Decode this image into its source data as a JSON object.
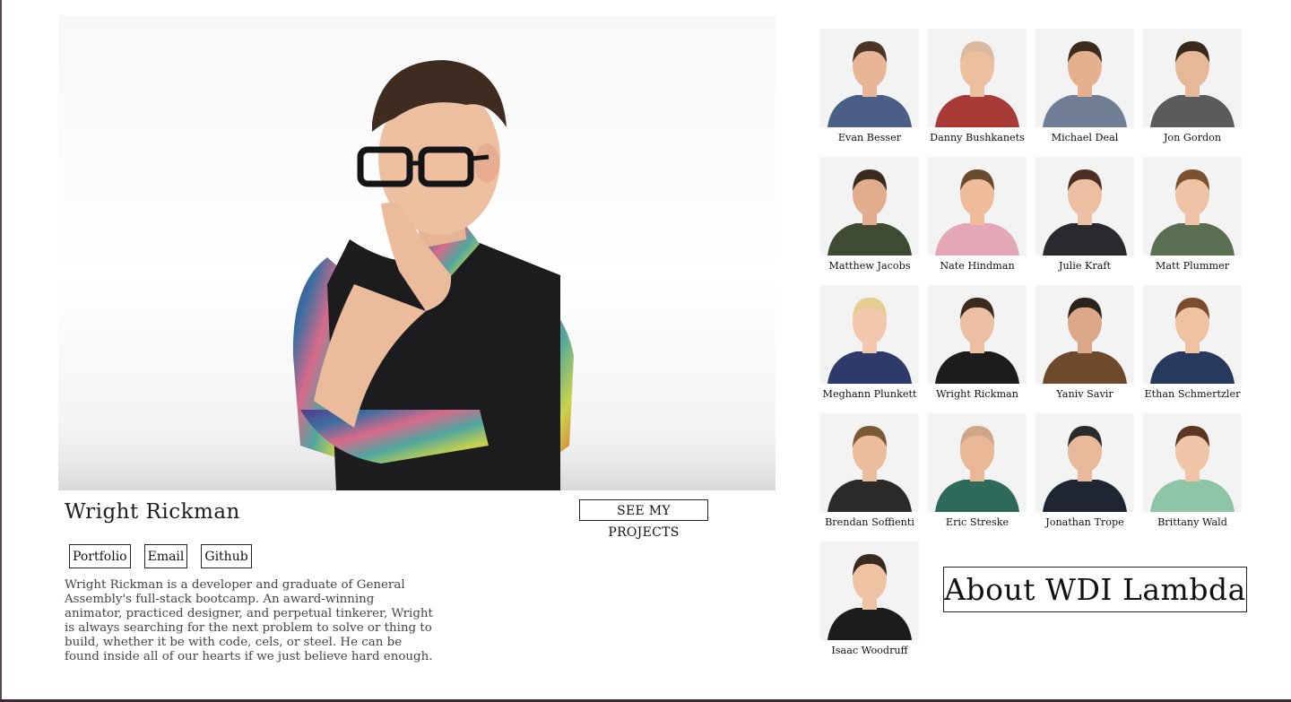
{
  "featured": {
    "name": "Wright Rickman",
    "projects_label": "SEE MY PROJECTS",
    "links": [
      "Portfolio",
      "Email",
      "Github"
    ],
    "bio": "Wright Rickman is a developer and graduate of General Assembly's full-stack bootcamp. An award-winning animator, practiced designer, and perpetual tinkerer, Wright is always searching for the next problem to solve or thing to build, whether it be with code, cels, or steel. He can be found inside all of our hearts if we just believe hard enough."
  },
  "people": [
    {
      "name": "Evan Besser",
      "shirt": "#4a5f86",
      "hair": "#4a3526",
      "skin": "#e8b596"
    },
    {
      "name": "Danny Bushkanets",
      "shirt": "#a83a38",
      "hair": "#d9b9a0",
      "skin": "#ecbf9f"
    },
    {
      "name": "Michael Deal",
      "shirt": "#6f7e94",
      "hair": "#3c2b1f",
      "skin": "#e4b08e"
    },
    {
      "name": "Jon Gordon",
      "shirt": "#5b5b5b",
      "hair": "#3a2a1e",
      "skin": "#e6b897"
    },
    {
      "name": "Matthew Jacobs",
      "shirt": "#3f4a33",
      "hair": "#3b2a1f",
      "skin": "#e1ad8c"
    },
    {
      "name": "Nate Hindman",
      "shirt": "#e3a7b8",
      "hair": "#6a4a2c",
      "skin": "#efbd9b"
    },
    {
      "name": "Julie Kraft",
      "shirt": "#2a2a2e",
      "hair": "#4a2f22",
      "skin": "#eec0a3"
    },
    {
      "name": "Matt Plummer",
      "shirt": "#5a6e52",
      "hair": "#7a5232",
      "skin": "#efc4a6"
    },
    {
      "name": "Meghann Plunkett",
      "shirt": "#2d3a6a",
      "hair": "#e3cd8f",
      "skin": "#f1c8ad"
    },
    {
      "name": "Wright Rickman",
      "shirt": "#1c1c1c",
      "hair": "#3b2a1e",
      "skin": "#edbfa2"
    },
    {
      "name": "Yaniv Savir",
      "shirt": "#6e4a2c",
      "hair": "#2a221c",
      "skin": "#dba88a"
    },
    {
      "name": "Ethan Schmertzler",
      "shirt": "#263a5c",
      "hair": "#7a4d2c",
      "skin": "#efc2a3"
    },
    {
      "name": "Brendan Soffienti",
      "shirt": "#2a2a2a",
      "hair": "#7a5a34",
      "skin": "#ecbd9c"
    },
    {
      "name": "Eric Streske",
      "shirt": "#2e6a5a",
      "hair": "#cfa68a",
      "skin": "#e9b696"
    },
    {
      "name": "Jonathan Trope",
      "shirt": "#1f2533",
      "hair": "#2a2a2a",
      "skin": "#e8b99a"
    },
    {
      "name": "Brittany Wald",
      "shirt": "#8ec4a8",
      "hair": "#5b3622",
      "skin": "#f0c5a8"
    },
    {
      "name": "Isaac Woodruff",
      "shirt": "#1c1c1c",
      "hair": "#3a2a1e",
      "skin": "#efc2a4"
    }
  ],
  "about_label": "About WDI Lambda"
}
